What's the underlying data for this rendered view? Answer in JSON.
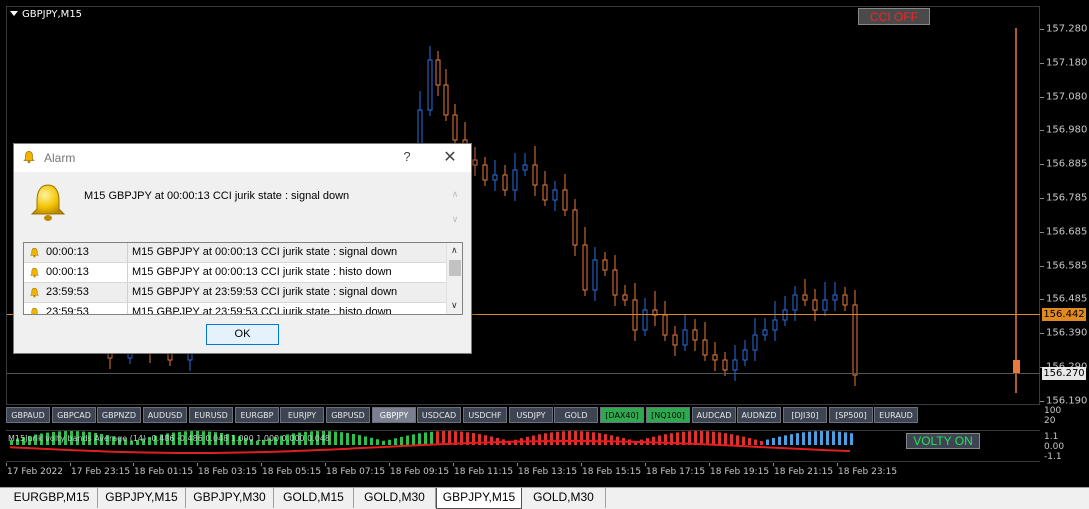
{
  "chart": {
    "title": "GBPJPY,M15",
    "cci_button": "CCI OFF",
    "price_labels": [
      "157.280",
      "157.180",
      "157.080",
      "156.980",
      "156.885",
      "156.785",
      "156.685",
      "156.585",
      "156.485",
      "156.390",
      "156.290",
      "156.190"
    ],
    "current_price": "156.442",
    "bid_price": "156.270",
    "colors": {
      "bull": "#2a6ee0",
      "bear": "#e87a3a",
      "current_line": "#e08a1f",
      "background": "#000000"
    }
  },
  "symbols": [
    "GBPAUD",
    "GBPCAD",
    "GBPNZD",
    "AUDUSD",
    "EURUSD",
    "EURGBP",
    "EURJPY",
    "GBPUSD",
    "GBPJPY",
    "USDCAD",
    "USDCHF",
    "USDJPY",
    "GOLD",
    "[DAX40]",
    "[NQ100]",
    "AUDCAD",
    "AUDNZD",
    "[DJI30]",
    "[SP500]",
    "EURAUD"
  ],
  "symbol_active": "GBPJPY",
  "symbol_green": [
    "[DAX40]",
    "[NQ100]"
  ],
  "sub_axis": {
    "top": "100",
    "bottom": "20"
  },
  "indicator": {
    "label": "M15Jurik volty bands Average (14) -0.486 -0.486 0.048 1.000 1.000 0.000 0.048",
    "volty_button": "VOLTY ON",
    "axis": [
      "1.1",
      "0.00",
      "-1.1"
    ]
  },
  "time_labels": [
    "17 Feb 2022",
    "17 Feb 23:15",
    "18 Feb 01:15",
    "18 Feb 03:15",
    "18 Feb 05:15",
    "18 Feb 07:15",
    "18 Feb 09:15",
    "18 Feb 11:15",
    "18 Feb 13:15",
    "18 Feb 15:15",
    "18 Feb 17:15",
    "18 Feb 19:15",
    "18 Feb 21:15",
    "18 Feb 23:15"
  ],
  "tabs": [
    "EURGBP,M15",
    "GBPJPY,M15",
    "GBPJPY,M30",
    "GOLD,M15",
    "GOLD,M30",
    "GBPJPY,M15",
    "GOLD,M30"
  ],
  "active_tab_index": 5,
  "alarm": {
    "title": "Alarm",
    "help_icon": "?",
    "close_icon": "✕",
    "message": "M15 GBPJPY at 00:00:13 CCI jurik state : signal down",
    "rows": [
      {
        "time": "00:00:13",
        "text": "M15 GBPJPY at 00:00:13 CCI jurik state : signal down"
      },
      {
        "time": "00:00:13",
        "text": "M15 GBPJPY at 00:00:13 CCI jurik state : histo down"
      },
      {
        "time": "23:59:53",
        "text": "M15 GBPJPY at 23:59:53 CCI jurik state : signal down"
      },
      {
        "time": "23:59:53",
        "text": "M15 GBPJPY at 23:59:53 CCI jurik state : histo down"
      }
    ],
    "ok_label": "OK"
  }
}
